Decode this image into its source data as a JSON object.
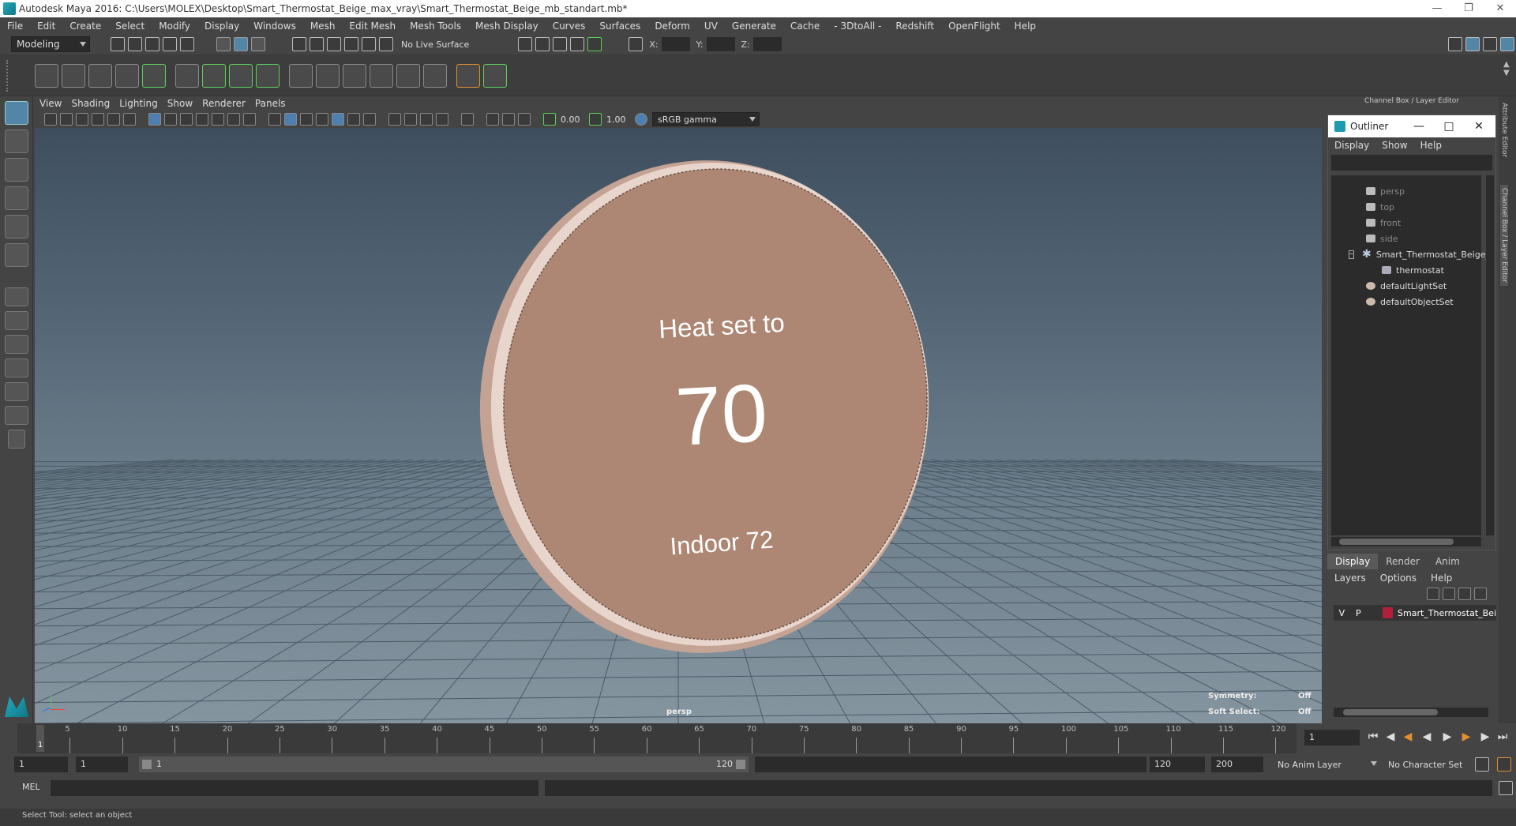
{
  "title": "Autodesk Maya 2016: C:\\Users\\MOLEX\\Desktop\\Smart_Thermostat_Beige_max_vray\\Smart_Thermostat_Beige_mb_standart.mb*",
  "menus": [
    "File",
    "Edit",
    "Create",
    "Select",
    "Modify",
    "Display",
    "Windows",
    "Mesh",
    "Edit Mesh",
    "Mesh Tools",
    "Mesh Display",
    "Curves",
    "Surfaces",
    "Deform",
    "UV",
    "Generate",
    "Cache",
    "- 3DtoAll -",
    "Redshift",
    "OpenFlight",
    "Help"
  ],
  "toolbar": {
    "workspace": "Modeling",
    "live_surface": "No Live Surface",
    "x_label": "X:",
    "y_label": "Y:",
    "z_label": "Z:"
  },
  "viewport": {
    "menu": [
      "View",
      "Shading",
      "Lighting",
      "Show",
      "Renderer",
      "Panels"
    ],
    "exposure": "0.00",
    "gamma": "1.00",
    "colorspace": "sRGB gamma",
    "camera_label": "persp",
    "hud": {
      "symmetry_label": "Symmetry:",
      "symmetry_value": "Off",
      "soft_select_label": "Soft Select:",
      "soft_select_value": "Off"
    },
    "thermostat": {
      "heading": "Heat set to",
      "temperature": "70",
      "indoor": "Indoor 72"
    }
  },
  "channel_box_title": "Channel Box / Layer Editor",
  "outliner": {
    "title": "Outliner",
    "menu": [
      "Display",
      "Show",
      "Help"
    ],
    "items": [
      {
        "label": "persp",
        "kind": "camera"
      },
      {
        "label": "top",
        "kind": "camera"
      },
      {
        "label": "front",
        "kind": "camera"
      },
      {
        "label": "side",
        "kind": "camera"
      },
      {
        "label": "Smart_Thermostat_Beige_r",
        "kind": "group"
      },
      {
        "label": "thermostat",
        "kind": "mesh"
      },
      {
        "label": "defaultLightSet",
        "kind": "set"
      },
      {
        "label": "defaultObjectSet",
        "kind": "set"
      }
    ]
  },
  "layers": {
    "tabs": [
      "Display",
      "Render",
      "Anim"
    ],
    "menu": [
      "Layers",
      "Options",
      "Help"
    ],
    "row": {
      "v": "V",
      "p": "P",
      "name": "Smart_Thermostat_Bei",
      "color": "#b0203a"
    }
  },
  "side_tabs": [
    "Attribute Editor",
    "Channel Box / Layer Editor"
  ],
  "timeline": {
    "ticks": [
      "5",
      "10",
      "15",
      "20",
      "25",
      "30",
      "35",
      "40",
      "45",
      "50",
      "55",
      "60",
      "65",
      "70",
      "75",
      "80",
      "85",
      "90",
      "95",
      "100",
      "105",
      "110",
      "115",
      "120"
    ],
    "current_frame": "1",
    "current_frame_field": "1"
  },
  "range": {
    "start": "1",
    "playback_start": "1",
    "slider_start": "1",
    "slider_end": "120",
    "playback_end": "120",
    "end": "200",
    "anim_layer": "No Anim Layer",
    "char_set": "No Character Set"
  },
  "command": {
    "lang": "MEL"
  },
  "status_text": "Select Tool: select an object"
}
